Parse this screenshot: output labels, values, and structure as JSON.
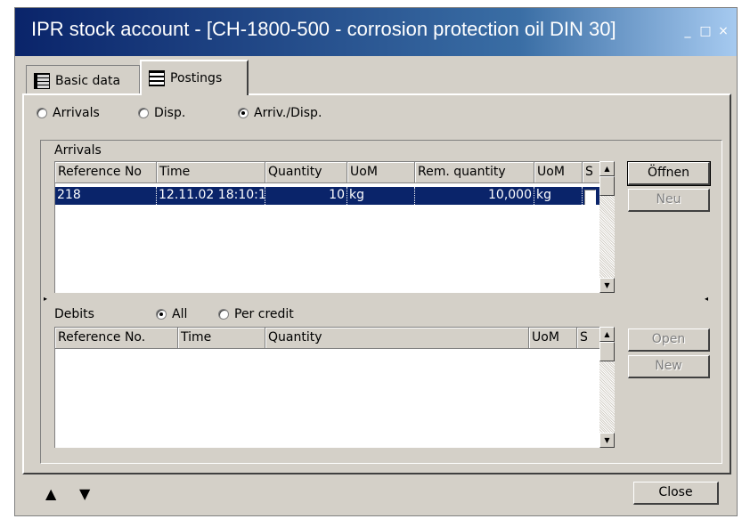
{
  "window": {
    "title": "IPR stock account - [CH-1800-500 - corrosion protection oil DIN 30]",
    "controls": [
      "_",
      "□",
      "×"
    ]
  },
  "tabs": [
    {
      "label": "Basic data",
      "icon": "book-icon"
    },
    {
      "label": "Postings",
      "icon": "list-icon"
    }
  ],
  "view_filter": {
    "options": [
      "Arrivals",
      "Disp.",
      "Arriv./Disp."
    ],
    "selected": "Arriv./Disp."
  },
  "arrivals": {
    "label": "Arrivals",
    "columns": [
      "Reference No",
      "Time",
      "Quantity",
      "UoM",
      "Rem. quantity",
      "UoM",
      "S"
    ],
    "rows": [
      {
        "ref": "218",
        "time": "12.11.02 18:10:1",
        "quantity": "10",
        "uom": "kg",
        "rem_quantity": "10,000",
        "rem_uom": "kg",
        "s": false
      }
    ],
    "buttons": {
      "open": "Öffnen",
      "new": "Neu"
    }
  },
  "debits": {
    "label": "Debits",
    "filter_options": [
      "All",
      "Per credit"
    ],
    "selected": "All",
    "columns": [
      "Reference No.",
      "Time",
      "Quantity",
      "UoM",
      "S"
    ],
    "rows": [],
    "buttons": {
      "open": "Open",
      "new": "New"
    }
  },
  "footer": {
    "close_label": "Close",
    "nav_icons": [
      "arrow-up-icon",
      "arrow-down-icon"
    ]
  },
  "colors": {
    "selection": "#0a246a",
    "face": "#d4d0c8",
    "title_start": "#0a246a",
    "title_end": "#a6caf0"
  }
}
